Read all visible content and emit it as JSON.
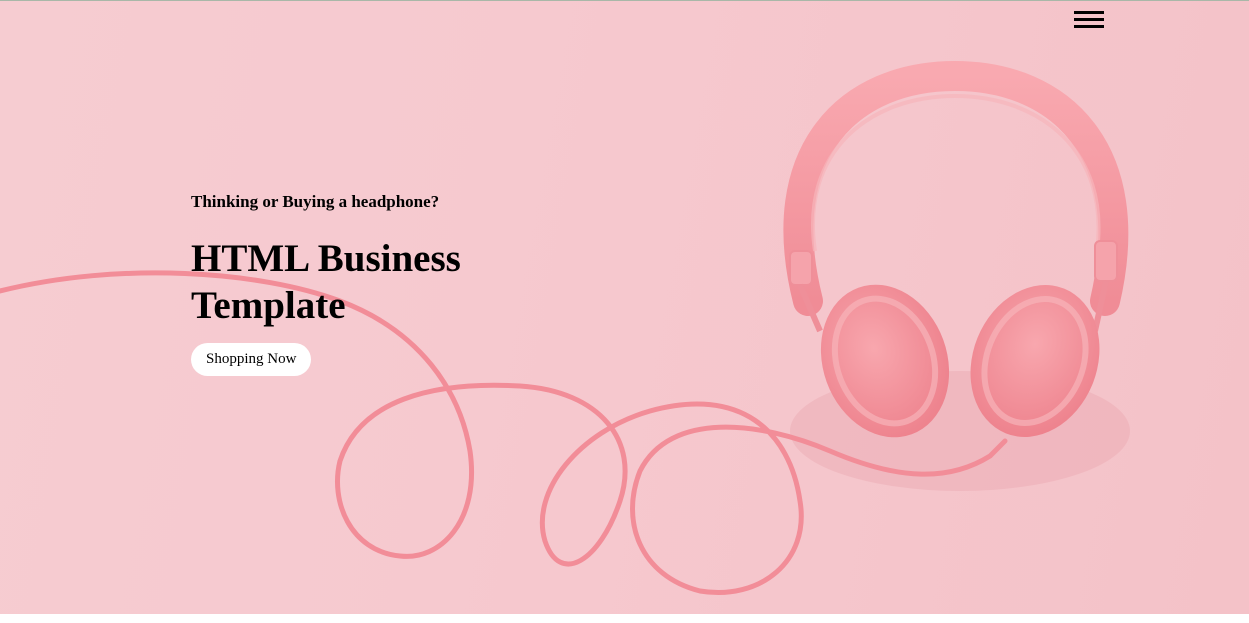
{
  "nav": {
    "menu_icon": "hamburger-menu-icon"
  },
  "hero": {
    "tagline": "Thinking or Buying a headphone?",
    "headline": "HTML Business Template",
    "cta_label": "Shopping Now",
    "image_subject": "pink headphones with cable",
    "colors": {
      "background": "#f6c9cf",
      "headphones": "#f59aa2",
      "cable": "#f28d98",
      "button_bg": "#ffffff",
      "text": "#000000"
    }
  }
}
